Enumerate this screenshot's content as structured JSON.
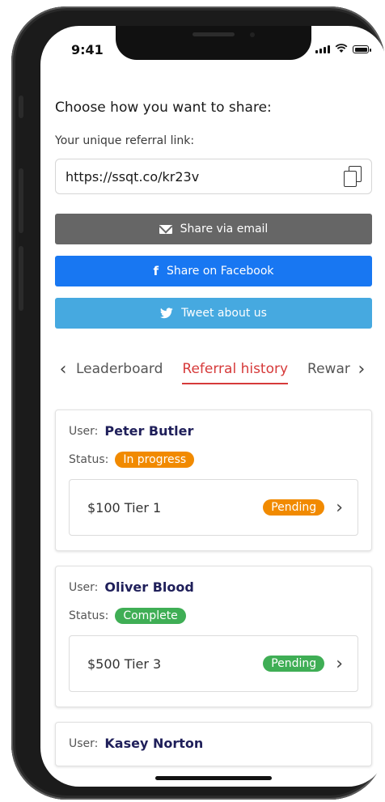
{
  "status_bar": {
    "time": "9:41"
  },
  "share": {
    "heading": "Choose how you want to share:",
    "link_label": "Your unique referral link:",
    "link_value": "https://ssqt.co/kr23v",
    "email_label": "Share via email",
    "facebook_label": "Share on Facebook",
    "twitter_label": "Tweet about us"
  },
  "tabs": {
    "items": [
      "Leaderboard",
      "Referral history",
      "Rewar"
    ],
    "active": "Referral history"
  },
  "referrals": [
    {
      "user_label": "User:",
      "user": "Peter Butler",
      "status_label": "Status:",
      "status": "In progress",
      "status_color": "#f18a00",
      "reward": "$100 Tier 1",
      "reward_status": "Pending",
      "reward_status_color": "#f18a00"
    },
    {
      "user_label": "User:",
      "user": "Oliver Blood",
      "status_label": "Status:",
      "status": "Complete",
      "status_color": "#3fae55",
      "reward": "$500 Tier 3",
      "reward_status": "Pending",
      "reward_status_color": "#3fae55"
    },
    {
      "user_label": "User:",
      "user": "Kasey Norton"
    }
  ],
  "colors": {
    "email": "#666666",
    "facebook": "#1877f2",
    "twitter": "#46a9e0",
    "active_tab": "#d63a3a"
  }
}
